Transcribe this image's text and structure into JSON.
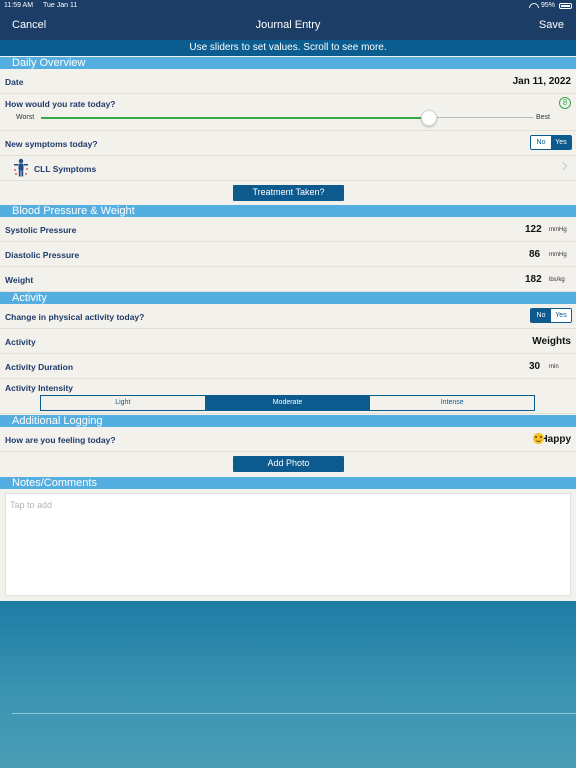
{
  "status_bar": {
    "time": "11:59 AM",
    "date": "Tue Jan 11",
    "battery": "95%"
  },
  "nav": {
    "cancel": "Cancel",
    "title": "Journal Entry",
    "save": "Save"
  },
  "hint": "Use sliders to set values. Scroll to see more.",
  "daily_overview": {
    "header": "Daily Overview",
    "date_label": "Date",
    "date_value": "Jan 11, 2022",
    "rating_label": "How would you rate today?",
    "rating_value": "8",
    "rating_fraction": 0.8,
    "worst_label": "Worst",
    "best_label": "Best",
    "symptoms_label": "New symptoms today?",
    "symptoms_no": "No",
    "symptoms_yes": "Yes",
    "symptoms_selected": "Yes",
    "cll_label": "CLL Symptoms",
    "treatment_button": "Treatment Taken?"
  },
  "blood_pressure": {
    "header": "Blood Pressure & Weight",
    "systolic_label": "Systolic Pressure",
    "systolic_value": "122",
    "systolic_unit": "mmHg",
    "diastolic_label": "Diastolic Pressure",
    "diastolic_value": "86",
    "diastolic_unit": "mmHg",
    "weight_label": "Weight",
    "weight_value": "182",
    "weight_unit": "lbs/kg"
  },
  "activity": {
    "header": "Activity",
    "change_label": "Change in physical activity today?",
    "change_no": "No",
    "change_yes": "Yes",
    "change_selected": "No",
    "activity_label": "Activity",
    "activity_value": "Weights",
    "duration_label": "Activity Duration",
    "duration_value": "30",
    "duration_unit": "min",
    "intensity_label": "Activity Intensity",
    "intensity_options": [
      "Light",
      "Moderate",
      "Intense"
    ],
    "intensity_selected": "Moderate"
  },
  "additional": {
    "header": "Additional Logging",
    "feeling_label": "How are you feeling today?",
    "feeling_value": "Happy",
    "add_photo": "Add Photo"
  },
  "notes": {
    "header": "Notes/Comments",
    "placeholder": "Tap to add"
  },
  "colors": {
    "nav_bg": "#1c3d66",
    "hint_bg": "#0b5d8f",
    "section_header": "#55aee0",
    "accent": "#0d5a8e",
    "slider_green": "#3aa64a"
  },
  "icons": {
    "battery": "battery-icon",
    "wifi": "wifi-icon",
    "cll": "body-figure-icon",
    "chevron": "chevron-right-icon",
    "emoji": "smiley-icon"
  }
}
